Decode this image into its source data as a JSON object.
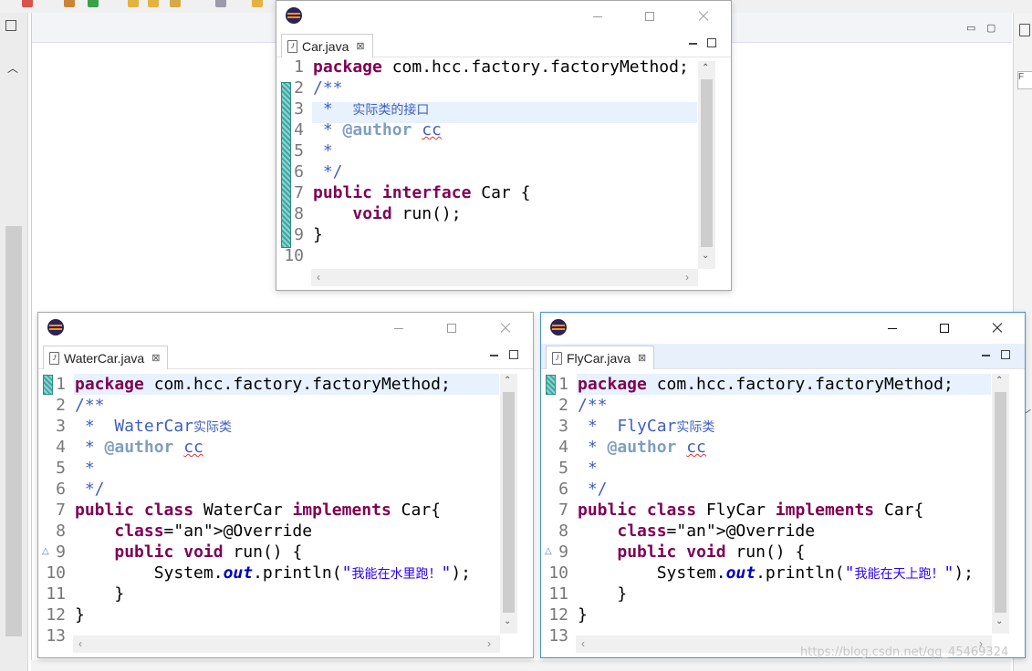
{
  "colors": {
    "keyword": "#7f0055",
    "comment": "#3f5fbf",
    "javadoc_tag": "#7f9fbf",
    "annotation": "#646464",
    "string": "#2a00ff",
    "field": "#0000c0",
    "current_line": "#e8f2fe",
    "active_border": "#4a90d9"
  },
  "windows": {
    "car": {
      "icon": "eclipse-icon",
      "tab": {
        "title": "Car.java",
        "close": "⊠"
      },
      "lines": [
        [
          "1",
          "package com.hcc.factory.factoryMethod;"
        ],
        [
          "2",
          "/**"
        ],
        [
          "3",
          " *  实际类的接口"
        ],
        [
          "4",
          " * @author cc"
        ],
        [
          "5",
          " *"
        ],
        [
          "6",
          " */"
        ],
        [
          "7",
          "public interface Car {"
        ],
        [
          "8",
          "    void run();"
        ],
        [
          "9",
          "}"
        ],
        [
          "10",
          ""
        ]
      ]
    },
    "watercar": {
      "icon": "eclipse-icon",
      "tab": {
        "title": "WaterCar.java",
        "close": "⊠"
      },
      "lines": [
        [
          "1",
          "package com.hcc.factory.factoryMethod;"
        ],
        [
          "2",
          "/**"
        ],
        [
          "3",
          " *  WaterCar实际类"
        ],
        [
          "4",
          " * @author cc"
        ],
        [
          "5",
          " *"
        ],
        [
          "6",
          " */"
        ],
        [
          "7",
          "public class WaterCar implements Car{"
        ],
        [
          "8",
          "    @Override"
        ],
        [
          "9",
          "    public void run() {"
        ],
        [
          "10",
          "        System.out.println(\"我能在水里跑！\");"
        ],
        [
          "11",
          "    }"
        ],
        [
          "12",
          "}"
        ],
        [
          "13",
          ""
        ]
      ]
    },
    "flycar": {
      "icon": "eclipse-icon",
      "tab": {
        "title": "FlyCar.java",
        "close": "⊠"
      },
      "lines": [
        [
          "1",
          "package com.hcc.factory.factoryMethod;"
        ],
        [
          "2",
          "/**"
        ],
        [
          "3",
          " *  FlyCar实际类"
        ],
        [
          "4",
          " * @author cc"
        ],
        [
          "5",
          " *"
        ],
        [
          "6",
          " */"
        ],
        [
          "7",
          "public class FlyCar implements Car{"
        ],
        [
          "8",
          "    @Override"
        ],
        [
          "9",
          "    public void run() {"
        ],
        [
          "10",
          "        System.out.println(\"我能在天上跑！\");"
        ],
        [
          "11",
          "    }"
        ],
        [
          "12",
          "}"
        ],
        [
          "13",
          ""
        ]
      ]
    }
  },
  "watermark": "https://blog.csdn.net/qq_45469324",
  "right_panel_label": "F"
}
